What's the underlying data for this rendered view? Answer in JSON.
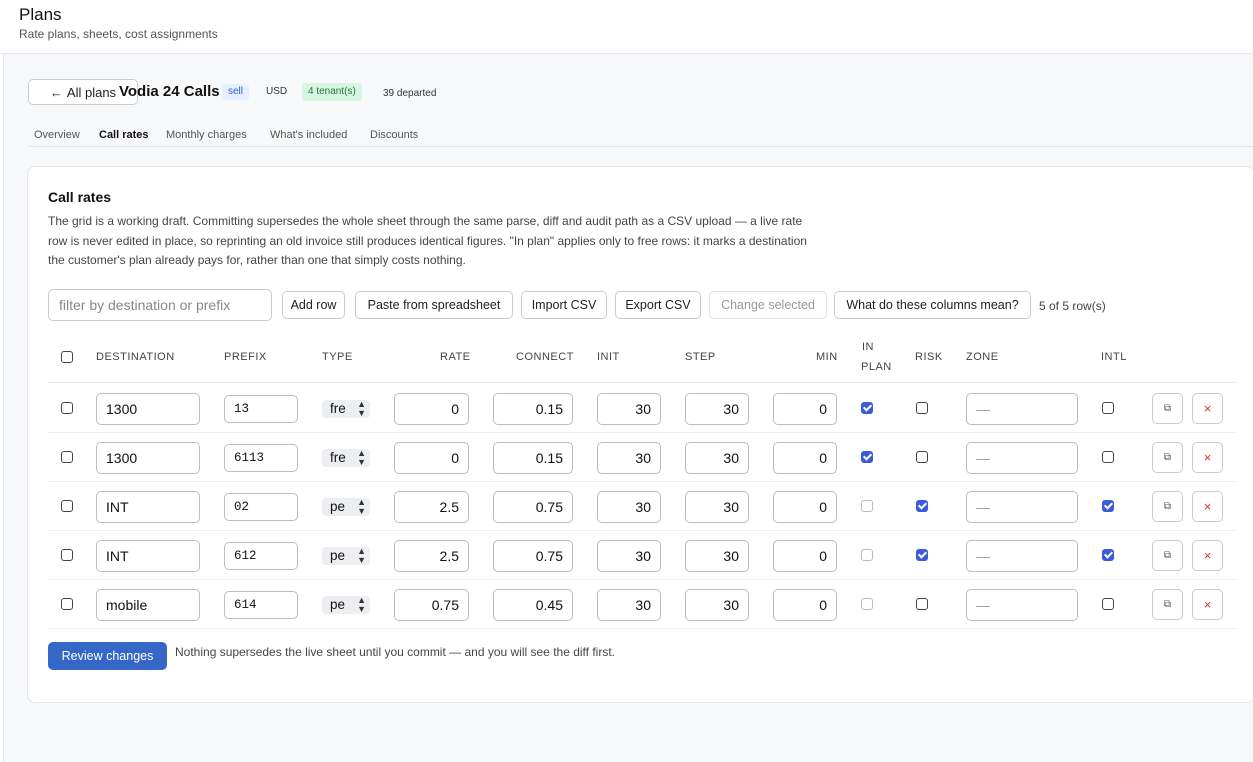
{
  "page": {
    "title": "Plans",
    "subtitle": "Rate plans, sheets, cost assignments"
  },
  "plan": {
    "back_label": "All plans",
    "name": "Vodia 24 Calls",
    "kind_badge": "sell",
    "currency": "USD",
    "tenant_badge": "4 tenant(s)",
    "departed": "39 departed"
  },
  "tabs": [
    {
      "label": "Overview",
      "active": false
    },
    {
      "label": "Call rates",
      "active": true
    },
    {
      "label": "Monthly charges",
      "active": false
    },
    {
      "label": "What's included",
      "active": false
    },
    {
      "label": "Discounts",
      "active": false
    }
  ],
  "card": {
    "title": "Call rates",
    "description": "The grid is a working draft. Committing supersedes the whole sheet through the same parse, diff and audit path as a CSV upload — a live rate row is never edited in place, so reprinting an old invoice still produces identical figures. \"In plan\" applies only to free rows: it marks a destination the customer's plan already pays for, rather than one that simply costs nothing."
  },
  "toolbar": {
    "filter_placeholder": "filter by destination or prefix",
    "add_row": "Add row",
    "paste": "Paste from spreadsheet",
    "import_csv": "Import CSV",
    "export_csv": "Export CSV",
    "change_selected": "Change selected",
    "help": "What do these columns mean?",
    "row_count": "5 of 5 row(s)"
  },
  "columns": {
    "destination": "DESTINATION",
    "prefix": "PREFIX",
    "type": "TYPE",
    "rate": "RATE",
    "connect": "CONNECT",
    "init": "INIT",
    "step": "STEP",
    "min": "MIN",
    "in_plan_1": "IN",
    "in_plan_2": "PLAN",
    "risk": "RISK",
    "zone": "ZONE",
    "intl": "INTL"
  },
  "rows": [
    {
      "destination": "1300",
      "prefix": "13",
      "type": "fre",
      "rate": "0",
      "connect": "0.15",
      "init": "30",
      "step": "30",
      "min": "0",
      "in_plan": true,
      "risk": false,
      "zone_placeholder": "—",
      "intl": false
    },
    {
      "destination": "1300",
      "prefix": "6113",
      "type": "fre",
      "rate": "0",
      "connect": "0.15",
      "init": "30",
      "step": "30",
      "min": "0",
      "in_plan": true,
      "risk": false,
      "zone_placeholder": "—",
      "intl": false
    },
    {
      "destination": "INT",
      "prefix": "02",
      "type": "pe",
      "rate": "2.5",
      "connect": "0.75",
      "init": "30",
      "step": "30",
      "min": "0",
      "in_plan": false,
      "risk": true,
      "zone_placeholder": "—",
      "intl": true
    },
    {
      "destination": "INT",
      "prefix": "612",
      "type": "pe",
      "rate": "2.5",
      "connect": "0.75",
      "init": "30",
      "step": "30",
      "min": "0",
      "in_plan": false,
      "risk": true,
      "zone_placeholder": "—",
      "intl": true
    },
    {
      "destination": "mobile",
      "prefix": "614",
      "type": "pe",
      "rate": "0.75",
      "connect": "0.45",
      "init": "30",
      "step": "30",
      "min": "0",
      "in_plan": false,
      "risk": false,
      "zone_placeholder": "—",
      "intl": false
    }
  ],
  "icons": {
    "back": "←",
    "duplicate": "⧉",
    "delete": "×",
    "select_arrows": "▲▼"
  },
  "footer": {
    "review_label": "Review changes",
    "note": "Nothing supersedes the live sheet until you commit — and you will see the diff first."
  },
  "colors": {
    "accent": "#3567c6",
    "checkbox": "#3b5bdb",
    "sell_badge": "#2a62c9",
    "tenant_badge": "#1d7a3c",
    "delete": "#dd3333"
  }
}
